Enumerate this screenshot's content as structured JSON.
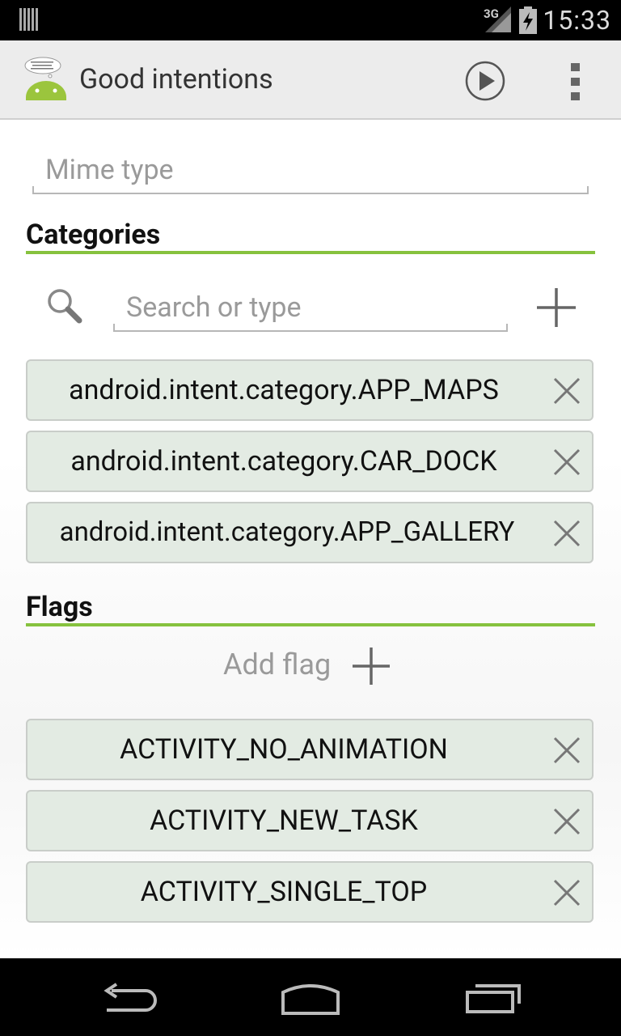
{
  "status_bar": {
    "time": "15:33",
    "network": "3G"
  },
  "action_bar": {
    "title": "Good intentions"
  },
  "mime": {
    "placeholder": "Mime type"
  },
  "categories": {
    "title": "Categories",
    "search_placeholder": "Search or type",
    "items": [
      {
        "label": "android.intent.category.APP_MAPS"
      },
      {
        "label": "android.intent.category.CAR_DOCK"
      },
      {
        "label": "android.intent.category.APP_GALLERY"
      }
    ]
  },
  "flags": {
    "title": "Flags",
    "add_label": "Add flag",
    "items": [
      {
        "label": "ACTIVITY_NO_ANIMATION"
      },
      {
        "label": "ACTIVITY_NEW_TASK"
      },
      {
        "label": "ACTIVITY_SINGLE_TOP"
      }
    ]
  },
  "colors": {
    "accent": "#86c23e",
    "chip_bg": "#e3ebe3"
  }
}
